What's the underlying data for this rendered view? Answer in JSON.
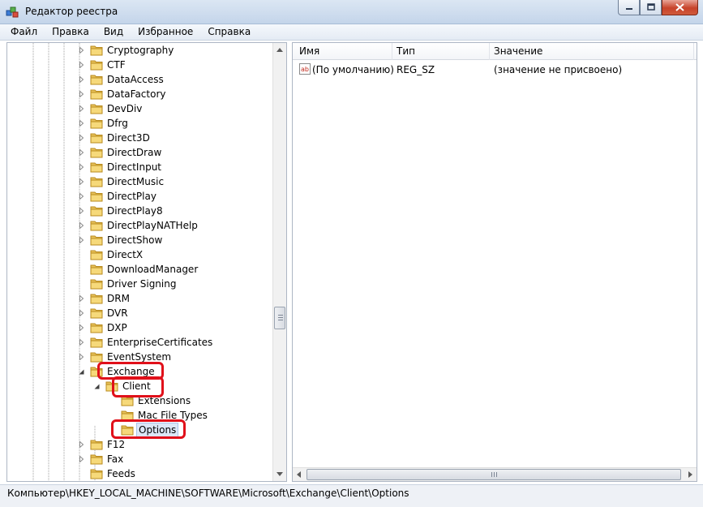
{
  "window": {
    "title": "Редактор реестра",
    "icon": "registry-editor-icon"
  },
  "menu": {
    "items": [
      "Файл",
      "Правка",
      "Вид",
      "Избранное",
      "Справка"
    ]
  },
  "tree": {
    "items": [
      {
        "label": "Cryptography",
        "expander": "collapsed"
      },
      {
        "label": "CTF",
        "expander": "collapsed"
      },
      {
        "label": "DataAccess",
        "expander": "collapsed"
      },
      {
        "label": "DataFactory",
        "expander": "collapsed"
      },
      {
        "label": "DevDiv",
        "expander": "collapsed"
      },
      {
        "label": "Dfrg",
        "expander": "collapsed"
      },
      {
        "label": "Direct3D",
        "expander": "collapsed"
      },
      {
        "label": "DirectDraw",
        "expander": "collapsed"
      },
      {
        "label": "DirectInput",
        "expander": "collapsed"
      },
      {
        "label": "DirectMusic",
        "expander": "collapsed"
      },
      {
        "label": "DirectPlay",
        "expander": "collapsed"
      },
      {
        "label": "DirectPlay8",
        "expander": "collapsed"
      },
      {
        "label": "DirectPlayNATHelp",
        "expander": "collapsed"
      },
      {
        "label": "DirectShow",
        "expander": "collapsed"
      },
      {
        "label": "DirectX",
        "expander": "none"
      },
      {
        "label": "DownloadManager",
        "expander": "none"
      },
      {
        "label": "Driver Signing",
        "expander": "none"
      },
      {
        "label": "DRM",
        "expander": "collapsed"
      },
      {
        "label": "DVR",
        "expander": "collapsed"
      },
      {
        "label": "DXP",
        "expander": "collapsed"
      },
      {
        "label": "EnterpriseCertificates",
        "expander": "collapsed"
      },
      {
        "label": "EventSystem",
        "expander": "collapsed"
      },
      {
        "label": "Exchange",
        "expander": "expanded"
      },
      {
        "label": "Client",
        "expander": "expanded"
      },
      {
        "label": "Extensions",
        "expander": "none"
      },
      {
        "label": "Mac File Types",
        "expander": "none"
      },
      {
        "label": "Options",
        "expander": "none",
        "selected": true
      },
      {
        "label": "F12",
        "expander": "collapsed"
      },
      {
        "label": "Fax",
        "expander": "collapsed"
      },
      {
        "label": "Feeds",
        "expander": "none"
      }
    ]
  },
  "list": {
    "columns": [
      "Имя",
      "Тип",
      "Значение"
    ],
    "rows": [
      {
        "name": "(По умолчанию)",
        "type": "REG_SZ",
        "value": "(значение не присвоено)",
        "icon": "string-value-icon"
      }
    ]
  },
  "status": {
    "path": "Компьютер\\HKEY_LOCAL_MACHINE\\SOFTWARE\\Microsoft\\Exchange\\Client\\Options"
  },
  "colors": {
    "highlight_annotation": "#e0101a",
    "selection_background": "#dbe7f7",
    "folder": "#e8c25a"
  }
}
